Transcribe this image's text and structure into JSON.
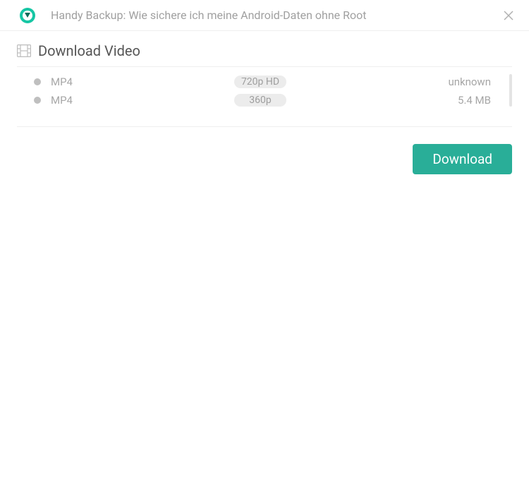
{
  "header": {
    "title": "Handy Backup: Wie sichere ich meine Android-Daten ohne Root"
  },
  "section": {
    "title": "Download Video"
  },
  "rows": [
    {
      "format": "MP4",
      "quality": "720p HD",
      "size": "unknown"
    },
    {
      "format": "MP4",
      "quality": "360p",
      "size": "5.4 MB"
    }
  ],
  "footer": {
    "download_label": "Download"
  }
}
